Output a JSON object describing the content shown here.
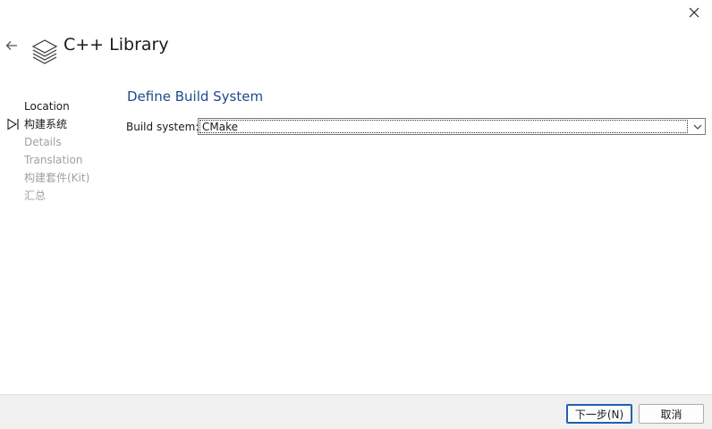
{
  "window": {
    "title": "C++ Library",
    "close_icon": "close-icon",
    "back_icon": "back-arrow-icon",
    "title_icon": "library-stack-icon"
  },
  "steps": [
    {
      "label": "Location",
      "state": "done"
    },
    {
      "label": "构建系统",
      "state": "current"
    },
    {
      "label": "Details",
      "state": "pending"
    },
    {
      "label": "Translation",
      "state": "pending"
    },
    {
      "label": "构建套件(Kit)",
      "state": "pending"
    },
    {
      "label": "汇总",
      "state": "pending"
    }
  ],
  "page": {
    "title": "Define Build System",
    "build_system": {
      "label": "Build system:",
      "value": "CMake"
    }
  },
  "footer": {
    "next_label": "下一步(N)",
    "cancel_label": "取消"
  },
  "colors": {
    "accent": "#1f4a8a",
    "footer_bg": "#f0f0f0",
    "pending_text": "#a0a0a0"
  }
}
